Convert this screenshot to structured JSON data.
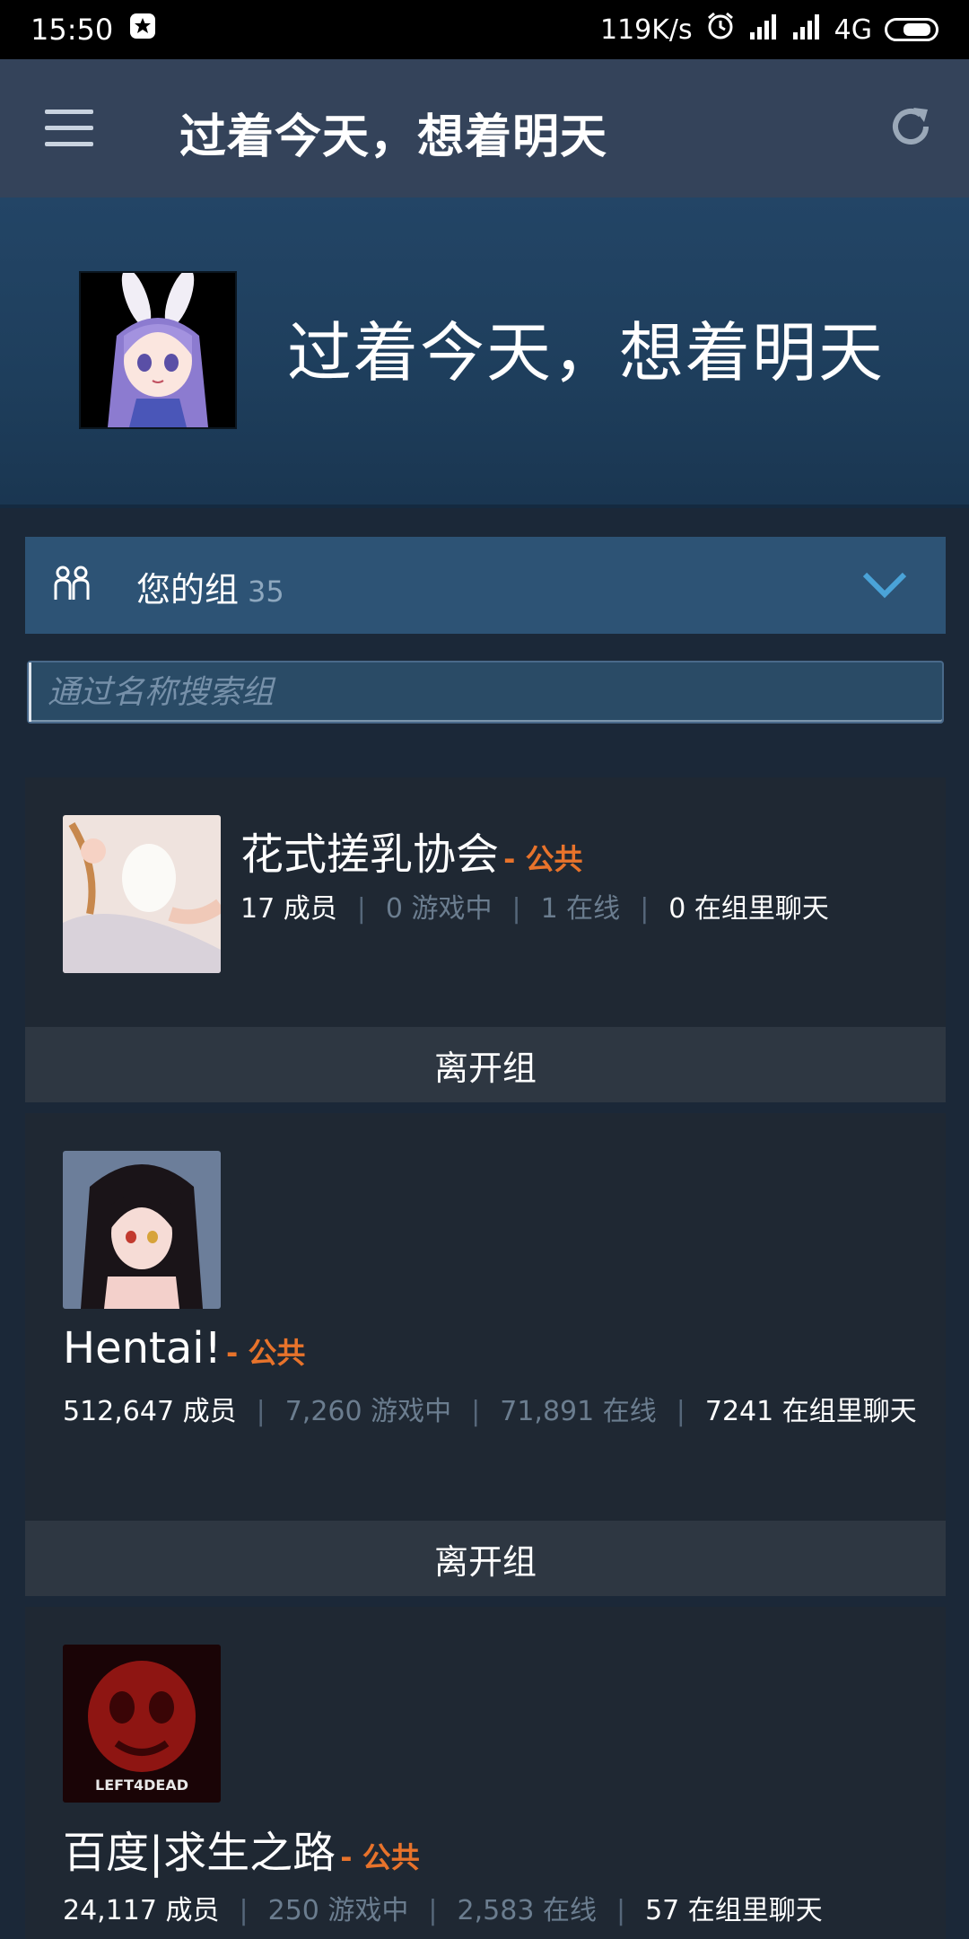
{
  "status_bar": {
    "time": "15:50",
    "net_speed": "119K/s",
    "network": "4G"
  },
  "header": {
    "title": "过着今天，想着明天"
  },
  "profile": {
    "name": "过着今天，想着明天"
  },
  "section": {
    "label": "您的组",
    "count": "35"
  },
  "search": {
    "placeholder": "通过名称搜索组"
  },
  "groups": [
    {
      "name": "花式搓乳协会",
      "visibility": "- 公共",
      "members": "17 成员",
      "in_game": "0 游戏中",
      "online": "1 在线",
      "chatting": "0 在组里聊天",
      "leave": "离开组"
    },
    {
      "name": "Hentai!",
      "visibility": "- 公共",
      "members": "512,647 成员",
      "in_game": "7,260 游戏中",
      "online": "71,891 在线",
      "chatting": "7241 在组里聊天",
      "leave": "离开组"
    },
    {
      "name": "百度|求生之路",
      "visibility": "- 公共",
      "members": "24,117 成员",
      "in_game": "250 游戏中",
      "online": "2,583 在线",
      "chatting": "57 在组里聊天",
      "thumb_caption": "LEFT4DEAD"
    }
  ],
  "colors": {
    "app_bar": "#34435a",
    "page_bg": "#1b2838",
    "card_bg": "#1f2833",
    "public_accent": "#e8732b",
    "section_bar": "#2d5375"
  }
}
